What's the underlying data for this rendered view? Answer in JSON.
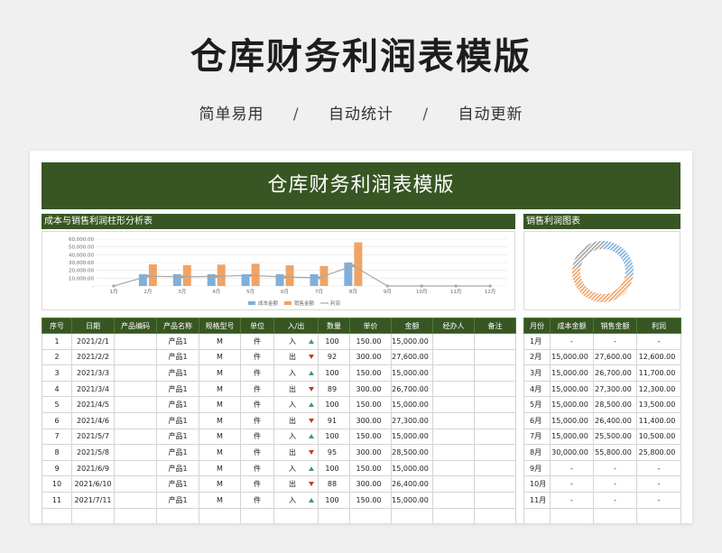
{
  "page": {
    "title": "仓库财务利润表模版",
    "tags": [
      "简单易用",
      "自动统计",
      "自动更新"
    ],
    "separator": "/"
  },
  "sheet": {
    "banner_title": "仓库财务利润表模版",
    "bar_section_title": "成本与销售利润柱形分析表",
    "donut_section_title": "销售利润图表"
  },
  "colors": {
    "header_green": "#375623",
    "cost": "#7fb0dc",
    "sales": "#f0a366",
    "profit": "#a6a6a6"
  },
  "chart_data": [
    {
      "type": "bar",
      "categories": [
        "1月",
        "2月",
        "3月",
        "4月",
        "5月",
        "6月",
        "7月",
        "8月",
        "9月",
        "10月",
        "11月",
        "12月"
      ],
      "series": [
        {
          "name": "成本金额",
          "type": "bar",
          "values": [
            null,
            15000,
            15000,
            15000,
            15000,
            15000,
            15000,
            30000,
            null,
            null,
            null,
            null
          ]
        },
        {
          "name": "销售金额",
          "type": "bar",
          "values": [
            null,
            27600,
            26700,
            27300,
            28500,
            26400,
            25500,
            55800,
            null,
            null,
            null,
            null
          ]
        },
        {
          "name": "利润",
          "type": "line",
          "values": [
            0,
            12600,
            11700,
            12300,
            13500,
            11400,
            10500,
            25800,
            0,
            0,
            0,
            0
          ]
        }
      ],
      "y_ticks": [
        "60,000.00",
        "50,000.00",
        "40,000.00",
        "30,000.00",
        "20,000.00",
        "10,000.00",
        "-"
      ],
      "ylim": [
        0,
        60000
      ],
      "legend": "bottom"
    },
    {
      "type": "pie",
      "variant": "donut",
      "series": [
        {
          "name": "成本金额",
          "values": [
            15000,
            15000,
            15000,
            15000,
            15000,
            15000,
            30000
          ]
        },
        {
          "name": "销售金额",
          "values": [
            27600,
            26700,
            27300,
            28500,
            26400,
            25500,
            55800
          ]
        },
        {
          "name": "利润",
          "values": [
            12600,
            11700,
            12300,
            13500,
            11400,
            10500,
            25800
          ]
        }
      ]
    }
  ],
  "main_table": {
    "headers": [
      "序号",
      "日期",
      "产品编码",
      "产品名称",
      "规格型号",
      "单位",
      "入/出",
      "数量",
      "单价",
      "金额",
      "经办人",
      "备注"
    ],
    "rows": [
      {
        "no": "1",
        "date": "2021/2/1",
        "code": "",
        "name": "产品1",
        "spec": "M",
        "unit": "件",
        "dir": "入",
        "dir_icon": "up",
        "qty": "100",
        "price": "150.00",
        "amount": "15,000.00",
        "handler": "",
        "note": ""
      },
      {
        "no": "2",
        "date": "2021/2/2",
        "code": "",
        "name": "产品1",
        "spec": "M",
        "unit": "件",
        "dir": "出",
        "dir_icon": "down",
        "qty": "92",
        "price": "300.00",
        "amount": "27,600.00",
        "handler": "",
        "note": ""
      },
      {
        "no": "3",
        "date": "2021/3/3",
        "code": "",
        "name": "产品1",
        "spec": "M",
        "unit": "件",
        "dir": "入",
        "dir_icon": "up",
        "qty": "100",
        "price": "150.00",
        "amount": "15,000.00",
        "handler": "",
        "note": ""
      },
      {
        "no": "4",
        "date": "2021/3/4",
        "code": "",
        "name": "产品1",
        "spec": "M",
        "unit": "件",
        "dir": "出",
        "dir_icon": "down",
        "qty": "89",
        "price": "300.00",
        "amount": "26,700.00",
        "handler": "",
        "note": ""
      },
      {
        "no": "5",
        "date": "2021/4/5",
        "code": "",
        "name": "产品1",
        "spec": "M",
        "unit": "件",
        "dir": "入",
        "dir_icon": "up",
        "qty": "100",
        "price": "150.00",
        "amount": "15,000.00",
        "handler": "",
        "note": ""
      },
      {
        "no": "6",
        "date": "2021/4/6",
        "code": "",
        "name": "产品1",
        "spec": "M",
        "unit": "件",
        "dir": "出",
        "dir_icon": "down",
        "qty": "91",
        "price": "300.00",
        "amount": "27,300.00",
        "handler": "",
        "note": ""
      },
      {
        "no": "7",
        "date": "2021/5/7",
        "code": "",
        "name": "产品1",
        "spec": "M",
        "unit": "件",
        "dir": "入",
        "dir_icon": "up",
        "qty": "100",
        "price": "150.00",
        "amount": "15,000.00",
        "handler": "",
        "note": ""
      },
      {
        "no": "8",
        "date": "2021/5/8",
        "code": "",
        "name": "产品1",
        "spec": "M",
        "unit": "件",
        "dir": "出",
        "dir_icon": "down",
        "qty": "95",
        "price": "300.00",
        "amount": "28,500.00",
        "handler": "",
        "note": ""
      },
      {
        "no": "9",
        "date": "2021/6/9",
        "code": "",
        "name": "产品1",
        "spec": "M",
        "unit": "件",
        "dir": "入",
        "dir_icon": "up",
        "qty": "100",
        "price": "150.00",
        "amount": "15,000.00",
        "handler": "",
        "note": ""
      },
      {
        "no": "10",
        "date": "2021/6/10",
        "code": "",
        "name": "产品1",
        "spec": "M",
        "unit": "件",
        "dir": "出",
        "dir_icon": "down",
        "qty": "88",
        "price": "300.00",
        "amount": "26,400.00",
        "handler": "",
        "note": ""
      },
      {
        "no": "11",
        "date": "2021/7/11",
        "code": "",
        "name": "产品1",
        "spec": "M",
        "unit": "件",
        "dir": "入",
        "dir_icon": "up",
        "qty": "100",
        "price": "150.00",
        "amount": "15,000.00",
        "handler": "",
        "note": ""
      }
    ]
  },
  "summary_table": {
    "headers": [
      "月份",
      "成本金额",
      "销售金额",
      "利润"
    ],
    "rows": [
      {
        "month": "1月",
        "cost": "-",
        "sales": "-",
        "profit": "-"
      },
      {
        "month": "2月",
        "cost": "15,000.00",
        "sales": "27,600.00",
        "profit": "12,600.00"
      },
      {
        "month": "3月",
        "cost": "15,000.00",
        "sales": "26,700.00",
        "profit": "11,700.00"
      },
      {
        "month": "4月",
        "cost": "15,000.00",
        "sales": "27,300.00",
        "profit": "12,300.00"
      },
      {
        "month": "5月",
        "cost": "15,000.00",
        "sales": "28,500.00",
        "profit": "13,500.00"
      },
      {
        "month": "6月",
        "cost": "15,000.00",
        "sales": "26,400.00",
        "profit": "11,400.00"
      },
      {
        "month": "7月",
        "cost": "15,000.00",
        "sales": "25,500.00",
        "profit": "10,500.00"
      },
      {
        "month": "8月",
        "cost": "30,000.00",
        "sales": "55,800.00",
        "profit": "25,800.00"
      },
      {
        "month": "9月",
        "cost": "-",
        "sales": "-",
        "profit": "-"
      },
      {
        "month": "10月",
        "cost": "-",
        "sales": "-",
        "profit": "-"
      },
      {
        "month": "11月",
        "cost": "-",
        "sales": "-",
        "profit": "-"
      }
    ]
  }
}
